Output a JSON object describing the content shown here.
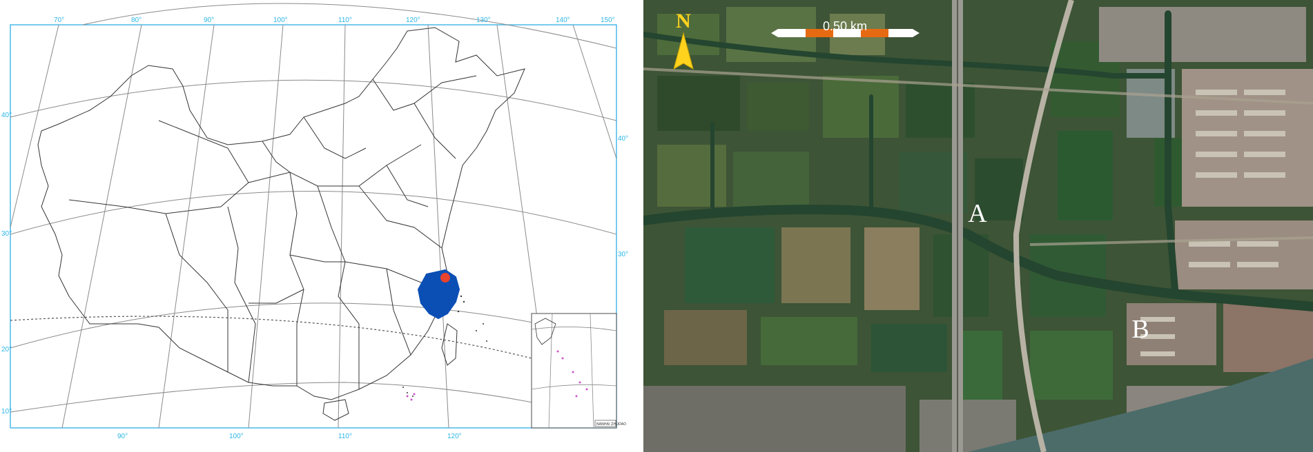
{
  "left_map": {
    "longitude_labels": [
      "70°",
      "80°",
      "90°",
      "100°",
      "110°",
      "120°",
      "130°",
      "140°",
      "150°"
    ],
    "latitude_labels_left": [
      "40°",
      "30°",
      "20°",
      "10°"
    ],
    "latitude_labels_right": [
      "40°",
      "30°"
    ],
    "inset_label": "NANHAI ZHUDAO",
    "highlight_region_color": "#0b4fb5",
    "marker_color": "#e8432d",
    "grid_color": "#7a7a7a",
    "frame_color": "#4ab8e8"
  },
  "right_map": {
    "north_label": "N",
    "scale_label": "0.50 km",
    "site_a_label": "A",
    "site_b_label": "B",
    "north_arrow_color": "#ffd21e",
    "scale_colors": [
      "#ffffff",
      "#e66a12"
    ]
  }
}
